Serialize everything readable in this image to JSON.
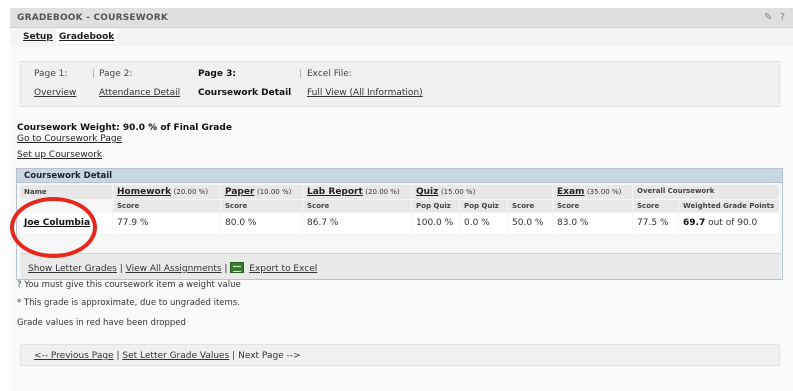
{
  "header": {
    "title": "GRADEBOOK - COURSEWORK",
    "icon_glyphs": [
      "✎",
      "?"
    ]
  },
  "tabs": [
    {
      "label": "Setup",
      "active": false
    },
    {
      "label": "Gradebook",
      "active": true
    }
  ],
  "page_nav": {
    "pages": [
      {
        "heading": "Page 1:",
        "link": "Overview"
      },
      {
        "heading": "Page 2:",
        "link": "Attendance Detail"
      },
      {
        "heading": "Page 3:",
        "current": "Coursework Detail"
      },
      {
        "heading": "Excel File:",
        "link": "Full View (All Information)"
      }
    ]
  },
  "coursework_weight": "Coursework Weight: 90.0 % of Final Grade",
  "links": {
    "go_to_coursework": "Go to Coursework Page",
    "set_up_coursework": "Set up Coursework"
  },
  "detail": {
    "title": "Coursework Detail",
    "name_header": "Name",
    "categories": [
      {
        "name": "Homework",
        "pct": "(20.00 %)"
      },
      {
        "name": "Paper",
        "pct": "(10.00 %)"
      },
      {
        "name": "Lab Report",
        "pct": "(20.00 %)"
      },
      {
        "name": "Quiz",
        "pct": "(15.00 %)"
      },
      {
        "name": "Exam",
        "pct": "(35.00 %)"
      }
    ],
    "overall_header": "Overall Coursework",
    "subheaders": [
      "Score",
      "Score",
      "Score",
      "Pop Quiz",
      "Pop Quiz",
      "Score",
      "Score",
      "Score",
      "Weighted Grade Points"
    ],
    "student": {
      "name": "Joe Columbia",
      "values": [
        "77.9 %",
        "80.0 %",
        "86.7 %",
        "100.0 %",
        "0.0 %",
        "50.0 %",
        "83.0 %",
        "77.5 %"
      ],
      "weighted_points": "69.7",
      "weighted_suffix": "out of 90.0"
    }
  },
  "actions": {
    "show_letter_grades": "Show Letter Grades",
    "view_all_assignments": "View All Assignments",
    "export_to_excel": "Export to Excel",
    "separator": "|"
  },
  "notes": [
    "? You must give this coursework item a weight value",
    "* This grade is approximate, due to ungraded items.",
    "Grade values in red have been dropped"
  ],
  "bottom_nav": {
    "previous": "<-- Previous Page",
    "letter_grades": "Set Letter Grade Values",
    "next": "Next Page -->",
    "separator": "|"
  },
  "colors": {
    "accent_header": "#c9d6e3",
    "highlight_ring": "#e5281b"
  }
}
